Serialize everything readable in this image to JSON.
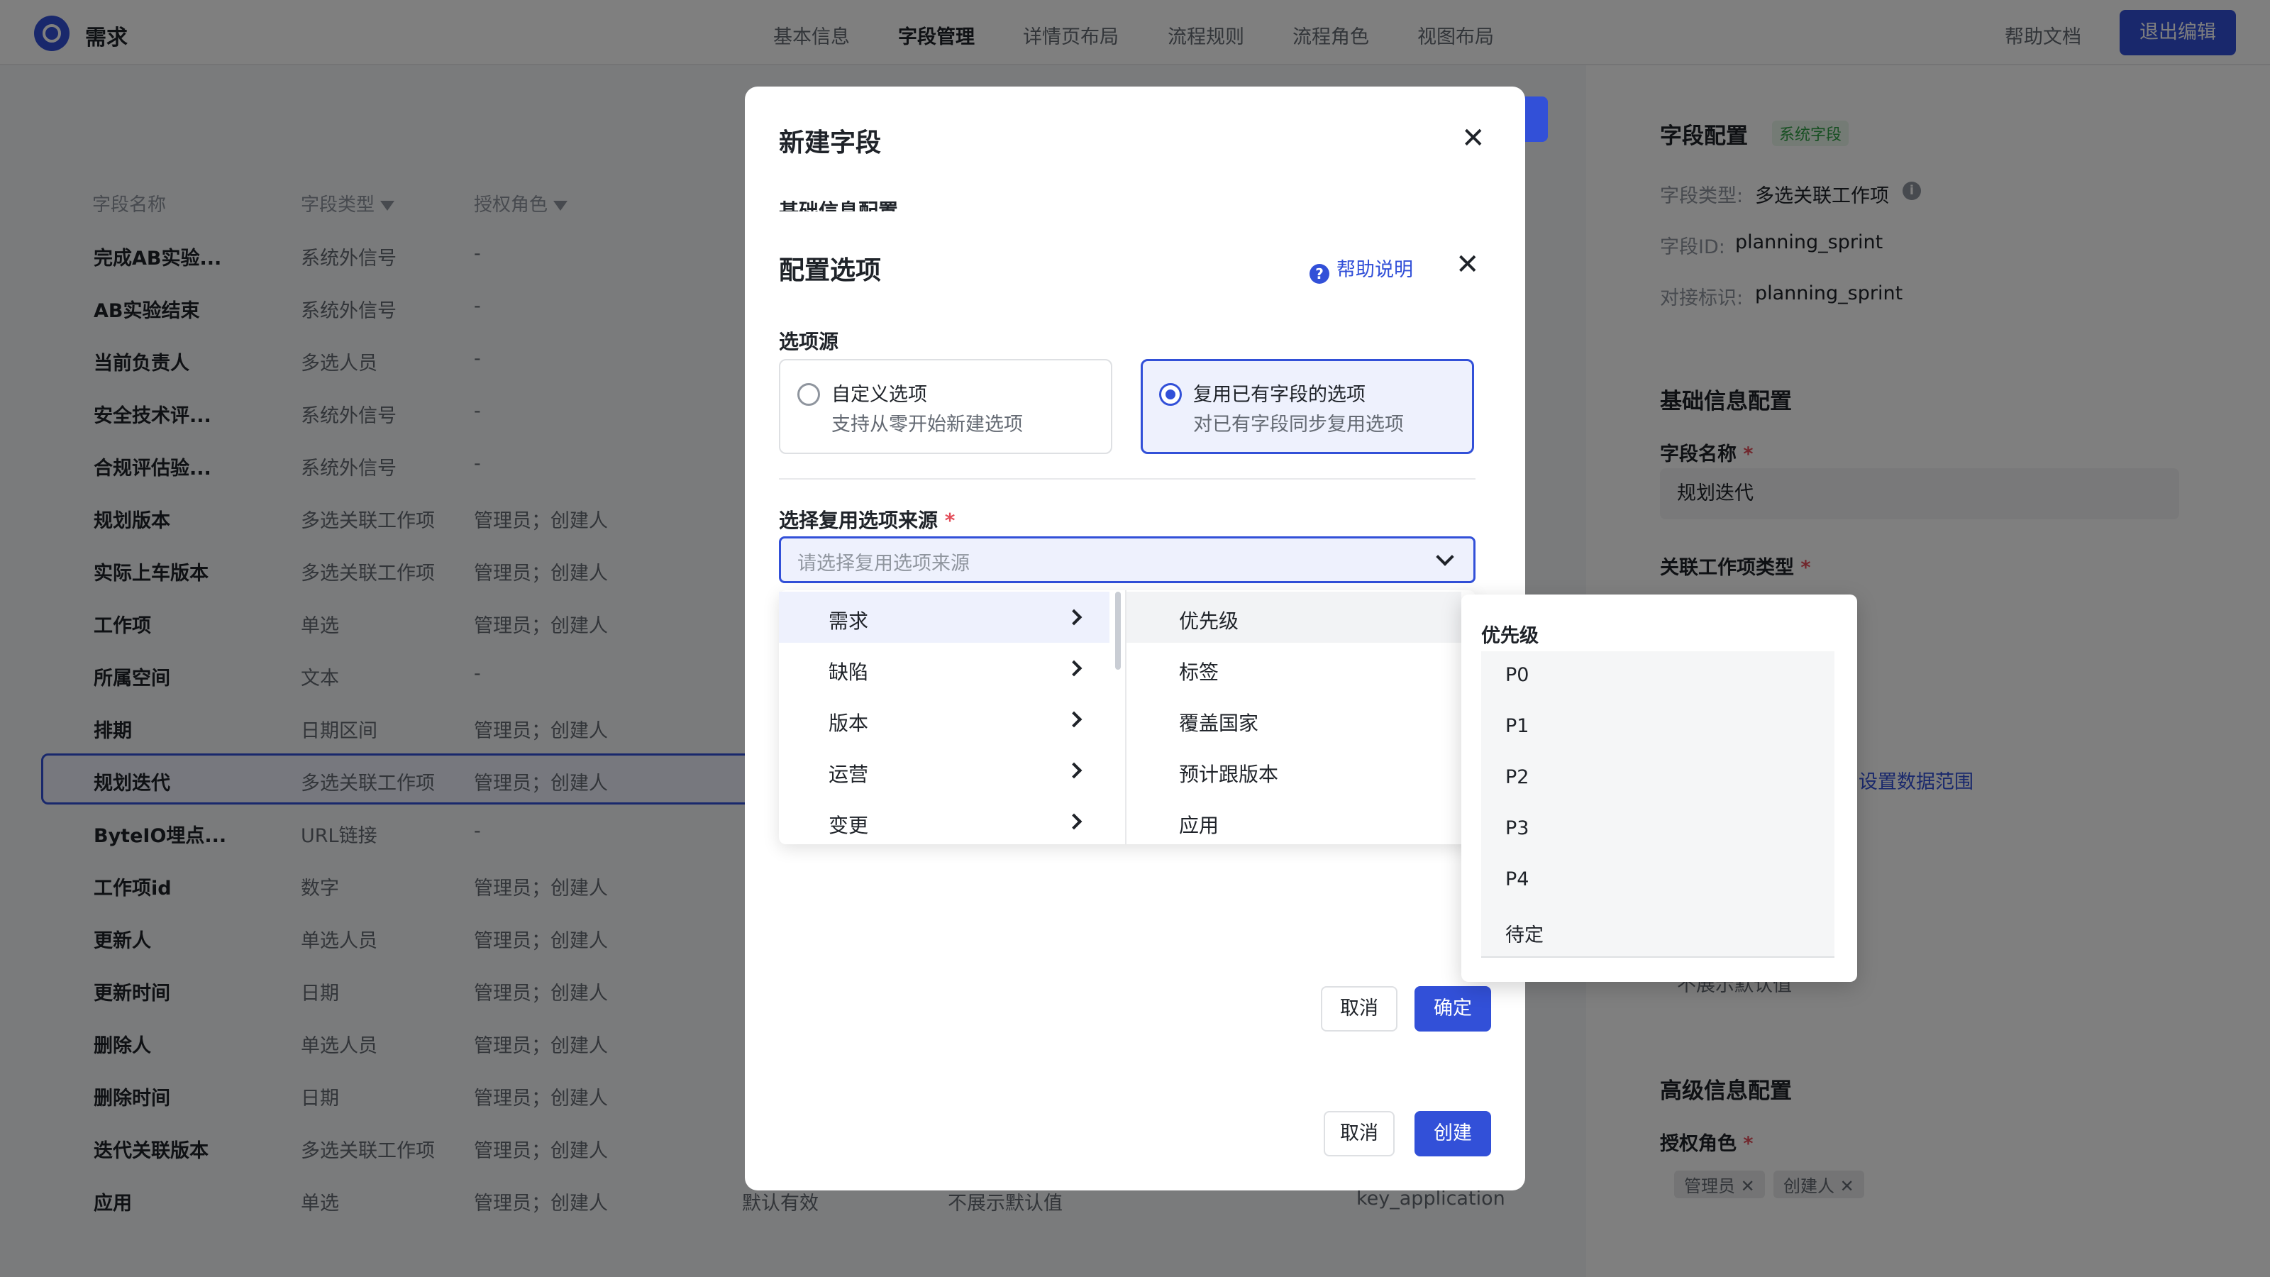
{
  "topbar": {
    "app_title": "需求",
    "nav": [
      "基本信息",
      "字段管理",
      "详情页布局",
      "流程规则",
      "流程角色",
      "视图布局"
    ],
    "help_doc": "帮助文档",
    "exit_edit": "退出编辑"
  },
  "table": {
    "headers": [
      "字段名称",
      "字段类型",
      "授权角色"
    ],
    "rows": [
      {
        "name": "完成AB实验...",
        "type": "系统外信号",
        "roles": "-"
      },
      {
        "name": "AB实验结束",
        "type": "系统外信号",
        "roles": "-"
      },
      {
        "name": "当前负责人",
        "type": "多选人员",
        "roles": "-"
      },
      {
        "name": "安全技术评...",
        "type": "系统外信号",
        "roles": "-"
      },
      {
        "name": "合规评估验...",
        "type": "系统外信号",
        "roles": "-"
      },
      {
        "name": "规划版本",
        "type": "多选关联工作项",
        "roles": "管理员；创建人"
      },
      {
        "name": "实际上车版本",
        "type": "多选关联工作项",
        "roles": "管理员；创建人"
      },
      {
        "name": "工作项",
        "type": "单选",
        "roles": "管理员；创建人"
      },
      {
        "name": "所属空间",
        "type": "文本",
        "roles": "-"
      },
      {
        "name": "排期",
        "type": "日期区间",
        "roles": "管理员；创建人"
      },
      {
        "name": "规划迭代",
        "type": "多选关联工作项",
        "roles": "管理员；创建人"
      },
      {
        "name": "ByteIO埋点...",
        "type": "URL链接",
        "roles": "-"
      },
      {
        "name": "工作项id",
        "type": "数字",
        "roles": "管理员；创建人"
      },
      {
        "name": "更新人",
        "type": "单选人员",
        "roles": "管理员；创建人"
      },
      {
        "name": "更新时间",
        "type": "日期",
        "roles": "管理员；创建人"
      },
      {
        "name": "删除人",
        "type": "单选人员",
        "roles": "管理员；创建人"
      },
      {
        "name": "删除时间",
        "type": "日期",
        "roles": "管理员；创建人"
      },
      {
        "name": "迭代关联版本",
        "type": "多选关联工作项",
        "roles": "管理员；创建人"
      },
      {
        "name": "应用",
        "type": "单选",
        "roles": "管理员；创建人"
      }
    ],
    "last_row_extra": {
      "default": "默认有效",
      "display": "不展示默认值",
      "key": "key_application"
    }
  },
  "right_panel": {
    "title": "字段配置",
    "tag": "系统字段",
    "field_type_label": "字段类型:",
    "field_type_value": "多选关联工作项",
    "field_id_label": "字段ID:",
    "field_id_value": "planning_sprint",
    "api_key_label": "对接标识:",
    "api_key_value": "planning_sprint",
    "basic_section": "基础信息配置",
    "name_label": "字段名称",
    "name_value": "规划迭代",
    "rel_type_label": "关联工作项类型",
    "data_range_link": "设置数据范围",
    "default_display": "不展示默认值",
    "advanced_section": "高级信息配置",
    "auth_role_label": "授权角色",
    "chips": [
      "管理员",
      "创建人"
    ]
  },
  "back_modal": {
    "title": "新建字段",
    "section": "基础信息配置",
    "cancel": "取消",
    "create": "创建"
  },
  "front_modal": {
    "title": "配置选项",
    "help": "帮助说明",
    "source_label": "选项源",
    "option_custom_title": "自定义选项",
    "option_custom_desc": "支持从零开始新建选项",
    "option_reuse_title": "复用已有字段的选项",
    "option_reuse_desc": "对已有字段同步复用选项",
    "reuse_source_label": "选择复用选项来源",
    "select_placeholder": "请选择复用选项来源",
    "cancel": "取消",
    "confirm": "确定"
  },
  "cascader": {
    "level1": [
      "需求",
      "缺陷",
      "版本",
      "运营",
      "变更"
    ],
    "level2": [
      "优先级",
      "标签",
      "覆盖国家",
      "预计跟版本",
      "应用"
    ]
  },
  "popover": {
    "title": "优先级",
    "items": [
      "P0",
      "P1",
      "P2",
      "P3",
      "P4",
      "待定"
    ]
  }
}
